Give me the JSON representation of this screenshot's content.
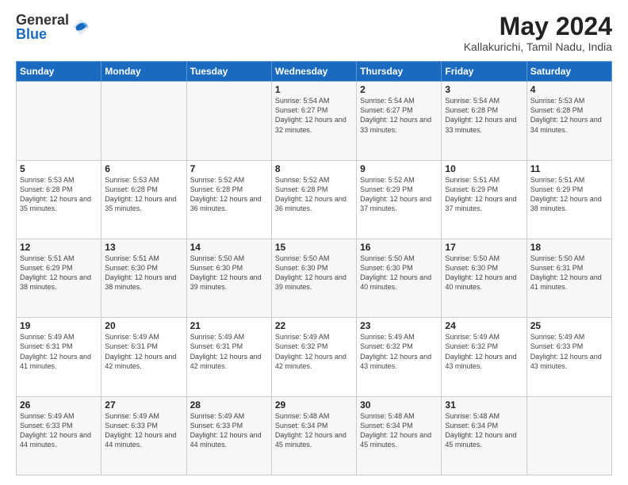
{
  "header": {
    "logo_general": "General",
    "logo_blue": "Blue",
    "month_year": "May 2024",
    "location": "Kallakurichi, Tamil Nadu, India"
  },
  "weekdays": [
    "Sunday",
    "Monday",
    "Tuesday",
    "Wednesday",
    "Thursday",
    "Friday",
    "Saturday"
  ],
  "weeks": [
    [
      {
        "day": "",
        "sunrise": "",
        "sunset": "",
        "daylight": ""
      },
      {
        "day": "",
        "sunrise": "",
        "sunset": "",
        "daylight": ""
      },
      {
        "day": "",
        "sunrise": "",
        "sunset": "",
        "daylight": ""
      },
      {
        "day": "1",
        "sunrise": "5:54 AM",
        "sunset": "6:27 PM",
        "daylight": "12 hours and 32 minutes."
      },
      {
        "day": "2",
        "sunrise": "5:54 AM",
        "sunset": "6:27 PM",
        "daylight": "12 hours and 33 minutes."
      },
      {
        "day": "3",
        "sunrise": "5:54 AM",
        "sunset": "6:28 PM",
        "daylight": "12 hours and 33 minutes."
      },
      {
        "day": "4",
        "sunrise": "5:53 AM",
        "sunset": "6:28 PM",
        "daylight": "12 hours and 34 minutes."
      }
    ],
    [
      {
        "day": "5",
        "sunrise": "5:53 AM",
        "sunset": "6:28 PM",
        "daylight": "12 hours and 35 minutes."
      },
      {
        "day": "6",
        "sunrise": "5:53 AM",
        "sunset": "6:28 PM",
        "daylight": "12 hours and 35 minutes."
      },
      {
        "day": "7",
        "sunrise": "5:52 AM",
        "sunset": "6:28 PM",
        "daylight": "12 hours and 36 minutes."
      },
      {
        "day": "8",
        "sunrise": "5:52 AM",
        "sunset": "6:28 PM",
        "daylight": "12 hours and 36 minutes."
      },
      {
        "day": "9",
        "sunrise": "5:52 AM",
        "sunset": "6:29 PM",
        "daylight": "12 hours and 37 minutes."
      },
      {
        "day": "10",
        "sunrise": "5:51 AM",
        "sunset": "6:29 PM",
        "daylight": "12 hours and 37 minutes."
      },
      {
        "day": "11",
        "sunrise": "5:51 AM",
        "sunset": "6:29 PM",
        "daylight": "12 hours and 38 minutes."
      }
    ],
    [
      {
        "day": "12",
        "sunrise": "5:51 AM",
        "sunset": "6:29 PM",
        "daylight": "12 hours and 38 minutes."
      },
      {
        "day": "13",
        "sunrise": "5:51 AM",
        "sunset": "6:30 PM",
        "daylight": "12 hours and 38 minutes."
      },
      {
        "day": "14",
        "sunrise": "5:50 AM",
        "sunset": "6:30 PM",
        "daylight": "12 hours and 39 minutes."
      },
      {
        "day": "15",
        "sunrise": "5:50 AM",
        "sunset": "6:30 PM",
        "daylight": "12 hours and 39 minutes."
      },
      {
        "day": "16",
        "sunrise": "5:50 AM",
        "sunset": "6:30 PM",
        "daylight": "12 hours and 40 minutes."
      },
      {
        "day": "17",
        "sunrise": "5:50 AM",
        "sunset": "6:30 PM",
        "daylight": "12 hours and 40 minutes."
      },
      {
        "day": "18",
        "sunrise": "5:50 AM",
        "sunset": "6:31 PM",
        "daylight": "12 hours and 41 minutes."
      }
    ],
    [
      {
        "day": "19",
        "sunrise": "5:49 AM",
        "sunset": "6:31 PM",
        "daylight": "12 hours and 41 minutes."
      },
      {
        "day": "20",
        "sunrise": "5:49 AM",
        "sunset": "6:31 PM",
        "daylight": "12 hours and 42 minutes."
      },
      {
        "day": "21",
        "sunrise": "5:49 AM",
        "sunset": "6:31 PM",
        "daylight": "12 hours and 42 minutes."
      },
      {
        "day": "22",
        "sunrise": "5:49 AM",
        "sunset": "6:32 PM",
        "daylight": "12 hours and 42 minutes."
      },
      {
        "day": "23",
        "sunrise": "5:49 AM",
        "sunset": "6:32 PM",
        "daylight": "12 hours and 43 minutes."
      },
      {
        "day": "24",
        "sunrise": "5:49 AM",
        "sunset": "6:32 PM",
        "daylight": "12 hours and 43 minutes."
      },
      {
        "day": "25",
        "sunrise": "5:49 AM",
        "sunset": "6:33 PM",
        "daylight": "12 hours and 43 minutes."
      }
    ],
    [
      {
        "day": "26",
        "sunrise": "5:49 AM",
        "sunset": "6:33 PM",
        "daylight": "12 hours and 44 minutes."
      },
      {
        "day": "27",
        "sunrise": "5:49 AM",
        "sunset": "6:33 PM",
        "daylight": "12 hours and 44 minutes."
      },
      {
        "day": "28",
        "sunrise": "5:49 AM",
        "sunset": "6:33 PM",
        "daylight": "12 hours and 44 minutes."
      },
      {
        "day": "29",
        "sunrise": "5:48 AM",
        "sunset": "6:34 PM",
        "daylight": "12 hours and 45 minutes."
      },
      {
        "day": "30",
        "sunrise": "5:48 AM",
        "sunset": "6:34 PM",
        "daylight": "12 hours and 45 minutes."
      },
      {
        "day": "31",
        "sunrise": "5:48 AM",
        "sunset": "6:34 PM",
        "daylight": "12 hours and 45 minutes."
      },
      {
        "day": "",
        "sunrise": "",
        "sunset": "",
        "daylight": ""
      }
    ]
  ]
}
